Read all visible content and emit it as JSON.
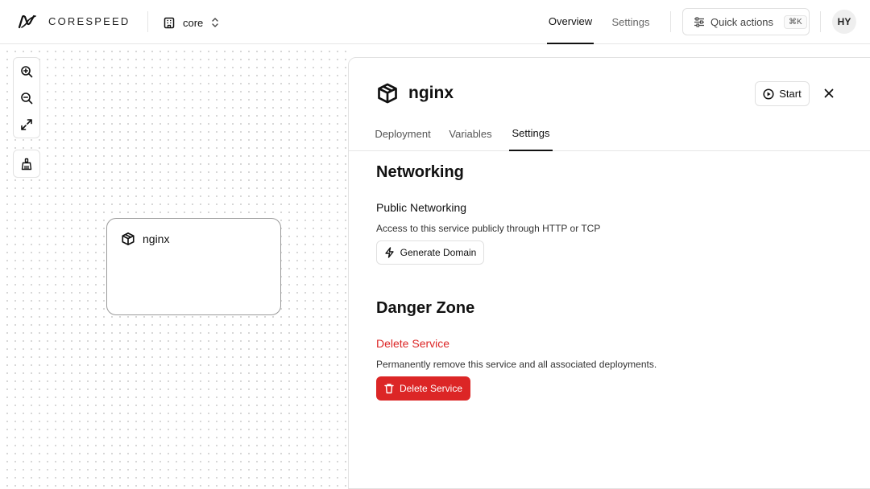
{
  "header": {
    "brand": "CORESPEED",
    "project_name": "core",
    "nav_tabs": [
      "Overview",
      "Settings"
    ],
    "active_nav": "Overview",
    "quick_actions_label": "Quick actions",
    "quick_actions_shortcut": "⌘K",
    "user_initials": "HY"
  },
  "canvas": {
    "tools": [
      "zoom-in",
      "zoom-out",
      "fit-view",
      "cleanup"
    ],
    "service_card": {
      "name": "nginx"
    }
  },
  "panel": {
    "service_name": "nginx",
    "start_label": "Start",
    "tabs": [
      "Deployment",
      "Variables",
      "Settings"
    ],
    "active_tab": "Settings",
    "networking": {
      "heading": "Networking",
      "public_title": "Public Networking",
      "public_desc": "Access to this service publicly through HTTP or TCP",
      "generate_label": "Generate Domain"
    },
    "danger": {
      "heading": "Danger Zone",
      "delete_title": "Delete Service",
      "delete_desc": "Permanently remove this service and all associated deployments.",
      "delete_label": "Delete Service"
    }
  },
  "colors": {
    "danger": "#dc2626",
    "text": "#111111",
    "border": "#e2e2e2"
  }
}
